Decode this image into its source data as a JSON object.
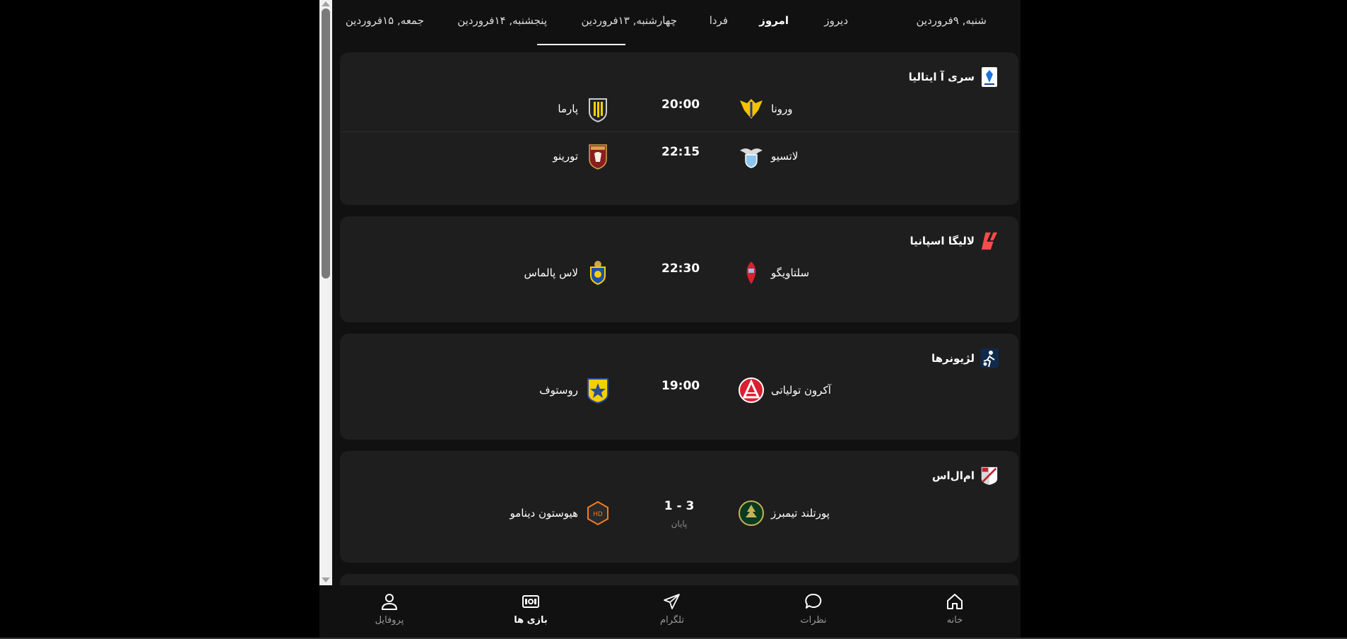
{
  "tabs": [
    {
      "label": "شنبه, ۹فروردین",
      "bold": false
    },
    {
      "label": "دیروز",
      "bold": false
    },
    {
      "label": "امروز",
      "bold": true
    },
    {
      "label": "فردا",
      "bold": false
    },
    {
      "label": "چهارشنبه, ۱۳فروردین",
      "bold": false
    },
    {
      "label": "پنجشنبه, ۱۴فروردین",
      "bold": false,
      "selected": true
    },
    {
      "label": "جمعه, ۱۵فروردین",
      "bold": false
    }
  ],
  "leagues": [
    {
      "name": "سری آ ایتالیا",
      "icon": "serie-a-icon",
      "matches": [
        {
          "home": "ورونا",
          "away": "پارما",
          "time": "20:00",
          "home_icon": "verona-crest-icon",
          "away_icon": "parma-crest-icon"
        },
        {
          "home": "لاتسیو",
          "away": "تورینو",
          "time": "22:15",
          "home_icon": "lazio-crest-icon",
          "away_icon": "torino-crest-icon"
        }
      ]
    },
    {
      "name": "لالیگا اسپانیا",
      "icon": "laliga-icon",
      "matches": [
        {
          "home": "سلتاویگو",
          "away": "لاس پالماس",
          "time": "22:30",
          "home_icon": "celta-crest-icon",
          "away_icon": "las-palmas-crest-icon"
        }
      ]
    },
    {
      "name": "لژیونرها",
      "icon": "legionnaires-icon",
      "matches": [
        {
          "home": "آکرون تولیاتی",
          "away": "روستوف",
          "time": "19:00",
          "home_icon": "akron-crest-icon",
          "away_icon": "rostov-crest-icon"
        }
      ]
    },
    {
      "name": "ام‌ال‌اس",
      "icon": "mls-icon",
      "matches": [
        {
          "home": "پورتلند تیمبرز",
          "away": "هیوستون دینامو",
          "time": "1 - 3",
          "status": "پایان",
          "home_icon": "portland-crest-icon",
          "away_icon": "houston-crest-icon"
        }
      ]
    }
  ],
  "nav": {
    "home": "خانه",
    "comments": "نظرات",
    "telegram": "تلگرام",
    "games": "بازی ها",
    "profile": "پروفایل"
  },
  "colors": {
    "background": "#000000",
    "panel": "#111111",
    "card": "#1e1e1e",
    "accent": "#ffffff",
    "laliga_red": "#ff3b3b"
  }
}
